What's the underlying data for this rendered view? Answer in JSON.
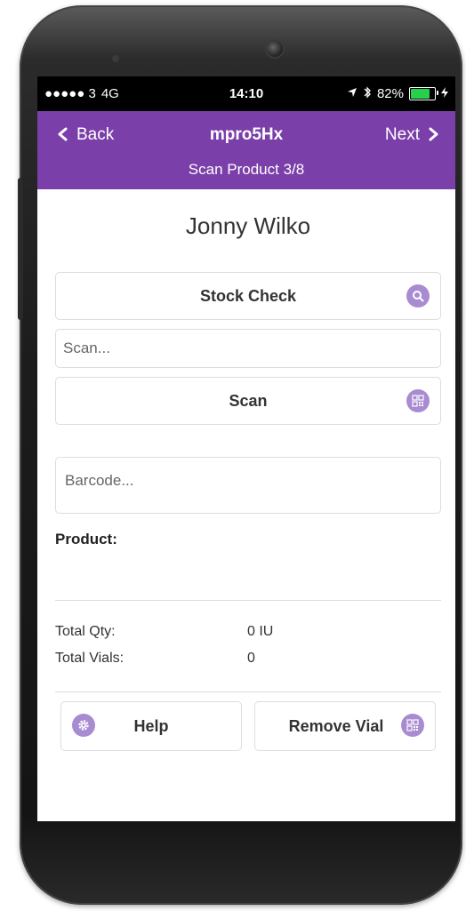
{
  "status_bar": {
    "carrier": "●●●●● 3",
    "network": "4G",
    "time": "14:10",
    "battery_text": "82%",
    "battery_level": 0.82,
    "battery_color": "#27d04b",
    "icons": [
      "location-icon",
      "bluetooth-icon",
      "battery-icon",
      "charging-icon"
    ]
  },
  "header": {
    "back_label": "Back",
    "title": "mpro5Hx",
    "next_label": "Next",
    "subtitle": "Scan Product 3/8",
    "background_color": "#7b3fa9"
  },
  "customer": {
    "name": "Jonny Wilko"
  },
  "stock_check": {
    "label": "Stock Check",
    "icon": "search-icon"
  },
  "scan_input": {
    "placeholder": "Scan..."
  },
  "scan_button": {
    "label": "Scan",
    "icon": "qr-code-icon"
  },
  "barcode_input": {
    "placeholder": "Barcode..."
  },
  "product": {
    "label": "Product:"
  },
  "totals": {
    "qty_label": "Total Qty:",
    "qty_value": "0 IU",
    "vials_label": "Total Vials:",
    "vials_value": "0"
  },
  "footer_buttons": {
    "help_label": "Help",
    "help_icon": "gear-icon",
    "remove_label": "Remove Vial",
    "remove_icon": "qr-code-icon"
  },
  "accent_icon_color": "#a98bd1"
}
